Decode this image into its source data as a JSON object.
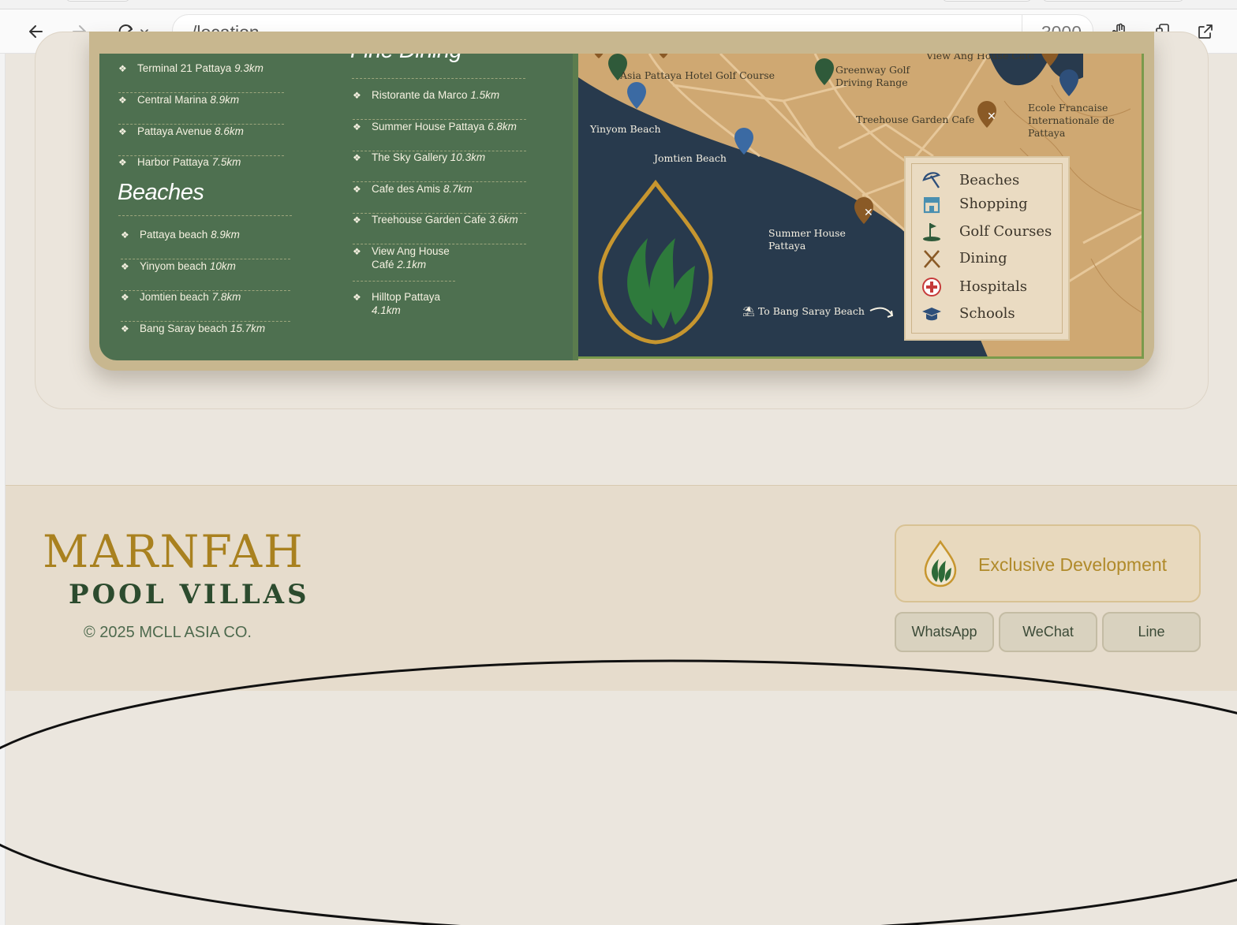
{
  "browser": {
    "address": "/location",
    "port": "3000"
  },
  "categories": {
    "shopping_items": [
      {
        "name": "Terminal 21 Pattaya",
        "distance": "9.3km"
      },
      {
        "name": "Central Marina",
        "distance": "8.9km"
      },
      {
        "name": "Pattaya Avenue",
        "distance": "8.6km"
      },
      {
        "name": "Harbor Pattaya",
        "distance": "7.5km"
      }
    ],
    "beaches_heading": "Beaches",
    "beaches_items": [
      {
        "name": "Pattaya beach",
        "distance": "8.9km"
      },
      {
        "name": "Yinyom beach",
        "distance": "10km"
      },
      {
        "name": "Jomtien beach",
        "distance": "7.8km"
      },
      {
        "name": "Bang Saray beach",
        "distance": "15.7km"
      }
    ],
    "dining_heading": "Fine Dining",
    "dining_items": [
      {
        "name": "Ristorante da Marco",
        "distance": "1.5km"
      },
      {
        "name": "Summer House Pattaya",
        "distance": "6.8km"
      },
      {
        "name": "The Sky Gallery",
        "distance": "10.3km"
      },
      {
        "name": "Cafe des Amis",
        "distance": "8.7km"
      },
      {
        "name": "Treehouse Garden Cafe",
        "distance": "3.6km"
      },
      {
        "name": "View Ang House",
        "name2": "Café",
        "distance": "2.1km"
      },
      {
        "name": "Hilltop Pattaya",
        "distance": "4.1km"
      }
    ],
    "bullet": "❖"
  },
  "map": {
    "labels": {
      "asia_golf": "Asia Pattaya Hotel Golf Course",
      "greenway_1": "Greenway Golf",
      "greenway_2": "Driving Range",
      "view_ang": "View Ang House Cafe",
      "treehouse": "Treehouse Garden Cafe",
      "ecole_1": "Ecole Francaise",
      "ecole_2": "Internationale de",
      "ecole_3": "Pattaya",
      "yinyom": "Yinyom Beach",
      "jomtien": "Jomtien Beach",
      "summer_1": "Summer House",
      "summer_2": "Pattaya",
      "bang_saray": "To Bang Saray Beach"
    },
    "colors": {
      "land": "#cfa872",
      "sea": "#283a4d",
      "road": "#e6c79a"
    },
    "legend": [
      {
        "icon": "beach-umbrella-icon",
        "label": "Beaches"
      },
      {
        "icon": "shop-icon",
        "label": "Shopping"
      },
      {
        "icon": "golf-icon",
        "label": "Golf Courses"
      },
      {
        "icon": "fork-knife-icon",
        "label": "Dining"
      },
      {
        "icon": "hospital-cross-icon",
        "label": "Hospitals"
      },
      {
        "icon": "graduation-cap-icon",
        "label": "Schools"
      }
    ]
  },
  "footer": {
    "brand_line1": "MARNFAH",
    "brand_line2": "POOL VILLAS",
    "copyright": "© 2025 MCLL ASIA CO.",
    "exclusive": "Exclusive Development",
    "contacts": [
      "WhatsApp",
      "WeChat",
      "Line"
    ],
    "colors": {
      "gold": "#a9811f",
      "green": "#2c4b2e"
    }
  }
}
